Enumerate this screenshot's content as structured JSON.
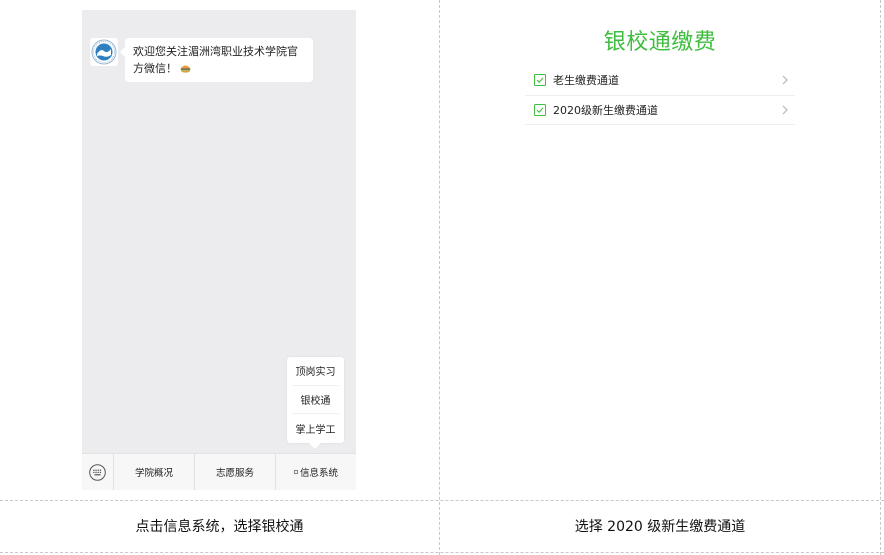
{
  "chat": {
    "welcome_message": "欢迎您关注湄洲湾职业技术学院官方微信！"
  },
  "submenu": {
    "items": [
      "顶岗实习",
      "银校通",
      "掌上学工"
    ]
  },
  "menubar": {
    "items": [
      "学院概况",
      "志愿服务",
      "信息系统"
    ]
  },
  "payment": {
    "title": "银校通缴费",
    "items": [
      "老生缴费通道",
      "2020级新生缴费通道"
    ]
  },
  "captions": {
    "left": "点击信息系统，选择银校通",
    "right": "选择 2020 级新生缴费通道"
  },
  "colors": {
    "accent_green": "#3fbd3f",
    "chat_background": "#ececee"
  }
}
